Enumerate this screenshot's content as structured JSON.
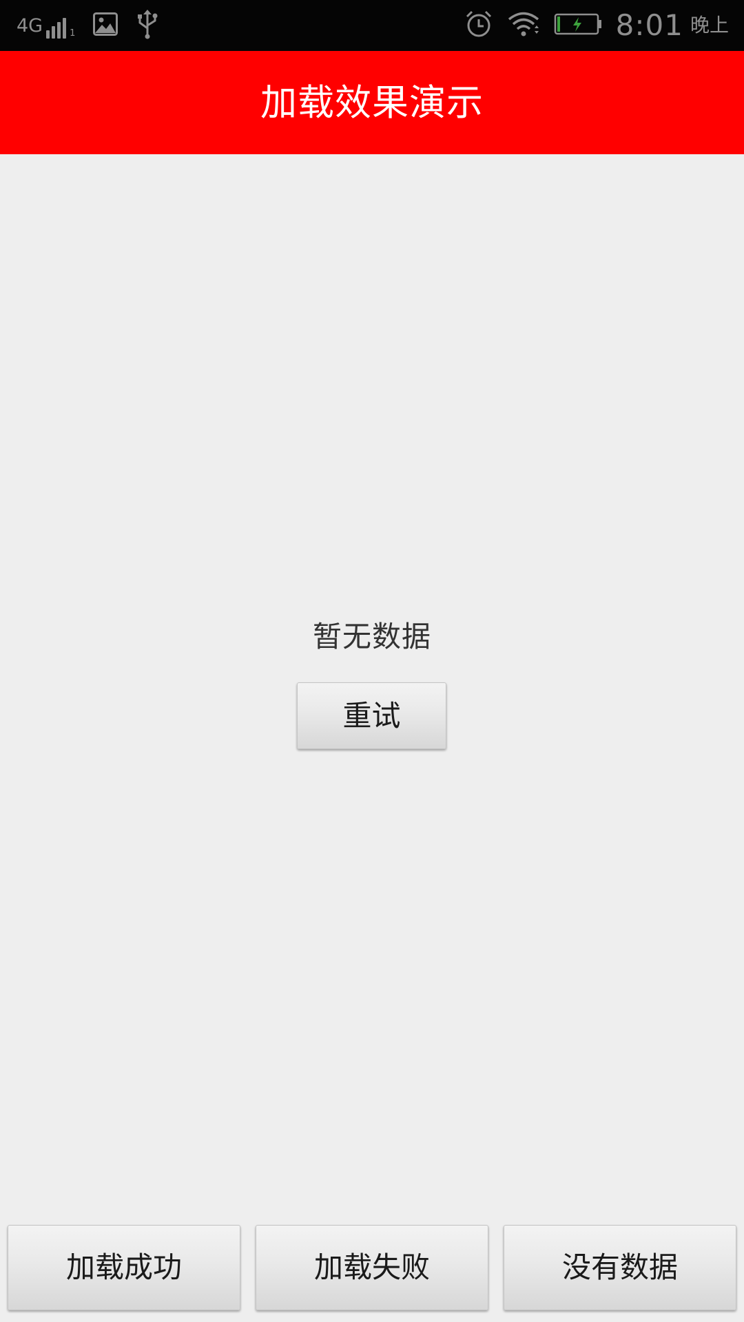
{
  "status_bar": {
    "network_label": "4G",
    "signal_sub": "1",
    "icons": [
      "gallery-icon",
      "usb-icon",
      "alarm-icon",
      "wifi-icon",
      "battery-charging-icon"
    ],
    "time": "8:01",
    "period": "晚上"
  },
  "app_bar": {
    "title": "加载效果演示",
    "color": "#ff0000"
  },
  "content": {
    "empty_text": "暂无数据",
    "retry_label": "重试"
  },
  "bottom_buttons": [
    {
      "label": "加载成功"
    },
    {
      "label": "加载失败"
    },
    {
      "label": "没有数据"
    }
  ]
}
